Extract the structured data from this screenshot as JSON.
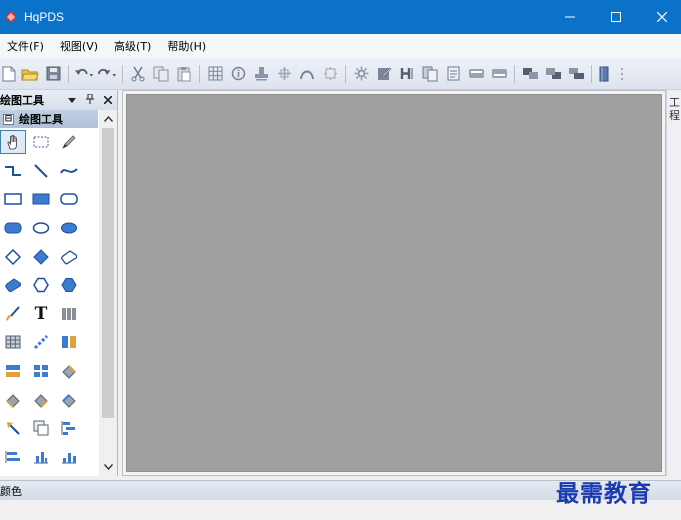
{
  "window": {
    "title": "HqPDS",
    "app_icon": "hqpds-logo-icon",
    "controls": [
      "minimize-icon",
      "maximize-icon",
      "close-icon"
    ]
  },
  "menu": {
    "items": [
      "文件(F)",
      "视图(V)",
      "高级(T)",
      "帮助(H)"
    ]
  },
  "toolbar": {
    "icons": [
      "new-file-icon",
      "open-folder-icon",
      "save-icon",
      "undo-icon",
      "redo-icon",
      "cut-icon",
      "copy-icon",
      "paste-icon",
      "grid-icon",
      "info-icon",
      "stamp-icon",
      "align-icon",
      "arc-icon",
      "frame-icon",
      "gear-icon",
      "edit-icon",
      "text-height-icon",
      "duplicate-icon",
      "insert-icon",
      "group-icon",
      "ungroup-icon",
      "bring-front-icon",
      "send-back-icon",
      "layer-icon",
      "book-icon"
    ]
  },
  "left_panel": {
    "title": "绘图工具",
    "dropdown_icon": "dropdown-arrow-icon",
    "pin_icon": "pin-icon",
    "close_icon": "close-icon",
    "group": {
      "title": "绘图工具",
      "collapse_symbol": "⊟"
    },
    "text_tool_glyph": "T"
  },
  "right_strip": {
    "label": "工程"
  },
  "bottom_panel": {
    "title": "颜色"
  },
  "watermark": {
    "text": "最需教育"
  },
  "colors": {
    "titlebar": "#0b72c9",
    "canvas": "#a0a0a0",
    "watermark": "#1a3bb0"
  }
}
